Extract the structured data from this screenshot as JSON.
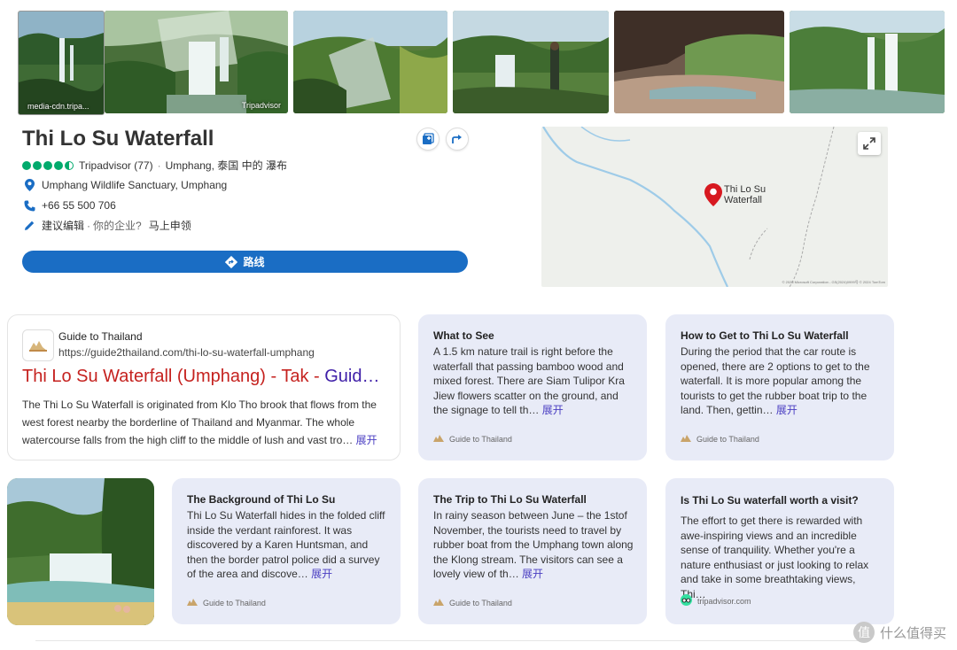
{
  "photos": {
    "first_caption": "media-cdn.tripa...",
    "watermark_label": "Tripadvisor"
  },
  "place": {
    "title": "Thi Lo Su Waterfall",
    "rating_source": "Tripadvisor (77)",
    "rating_value": 4.5,
    "category": "Umphang, 泰国 中的 瀑布",
    "address": "Umphang Wildlife Sanctuary, Umphang",
    "phone": "+66 55 500 706",
    "suggest_edit": "建议编辑",
    "your_business": "你的企业?",
    "claim": "马上申领",
    "route_label": "路线"
  },
  "map": {
    "pin_label_line1": "Thi Lo Su",
    "pin_label_line2": "Waterfall",
    "credit": "© 2025 Microsoft Corporation - GS(2024)0999号 © 2024 TomTom"
  },
  "result": {
    "site_name": "Guide to Thailand",
    "url": "https://guide2thailand.com/thi-lo-su-waterfall-umphang",
    "title_part1": "Thi Lo Su Waterfall (Umphang) - Tak - ",
    "title_part2": "Guid…",
    "description": "The Thi Lo Su Waterfall is originated from Klo Tho brook that flows from the west forest nearby the borderline of Thailand and Myanmar. The whole watercourse falls from the high cliff to the middle of lush and vast tro…",
    "more": "展开"
  },
  "cards": [
    {
      "title": "What to See",
      "body": "A 1.5 km nature trail is right before the waterfall that passing bamboo wood and mixed forest. There are Siam Tulipor Kra Jiew flowers scatter on the ground, and the signage to tell th…",
      "more": "展开",
      "source": "Guide to Thailand"
    },
    {
      "title": "How to Get to Thi Lo Su Waterfall",
      "body": "During the period that the car route is opened, there are 2 options to get to the waterfall. It is more popular among the tourists to get the rubber boat trip to the land. Then, gettin…",
      "more": "展开",
      "source": "Guide to Thailand"
    },
    {
      "title": "The Background of Thi Lo Su",
      "body": "Thi Lo Su Waterfall hides in the folded cliff inside the verdant rainforest. It was discovered by a Karen Huntsman, and then the border patrol police did a survey of the area and discove…",
      "more": "展开",
      "source": "Guide to Thailand"
    },
    {
      "title": "The Trip to Thi Lo Su Waterfall",
      "body": "In rainy season between June – the 1stof November, the tourists need to travel by rubber boat from the Umphang town along the Klong stream. The visitors can see a lovely view of th…",
      "more": "展开",
      "source": "Guide to Thailand"
    },
    {
      "title": "Is Thi Lo Su waterfall worth a visit?",
      "body": "The effort to get there is rewarded with awe-inspiring views and an incredible sense of tranquility. Whether you're a nature enthusiast or just looking to relax and take in some breathtaking views, Thi…",
      "more": "",
      "source": "tripadvisor.com"
    }
  ],
  "watermark": {
    "icon": "值",
    "text": "什么值得买"
  },
  "colors": {
    "rating_green": "#00aa6c",
    "route_blue": "#1a6dc4",
    "card_bg": "#e8ebf7",
    "link_red": "#c5221f",
    "link_purple": "#3f1fa8"
  }
}
